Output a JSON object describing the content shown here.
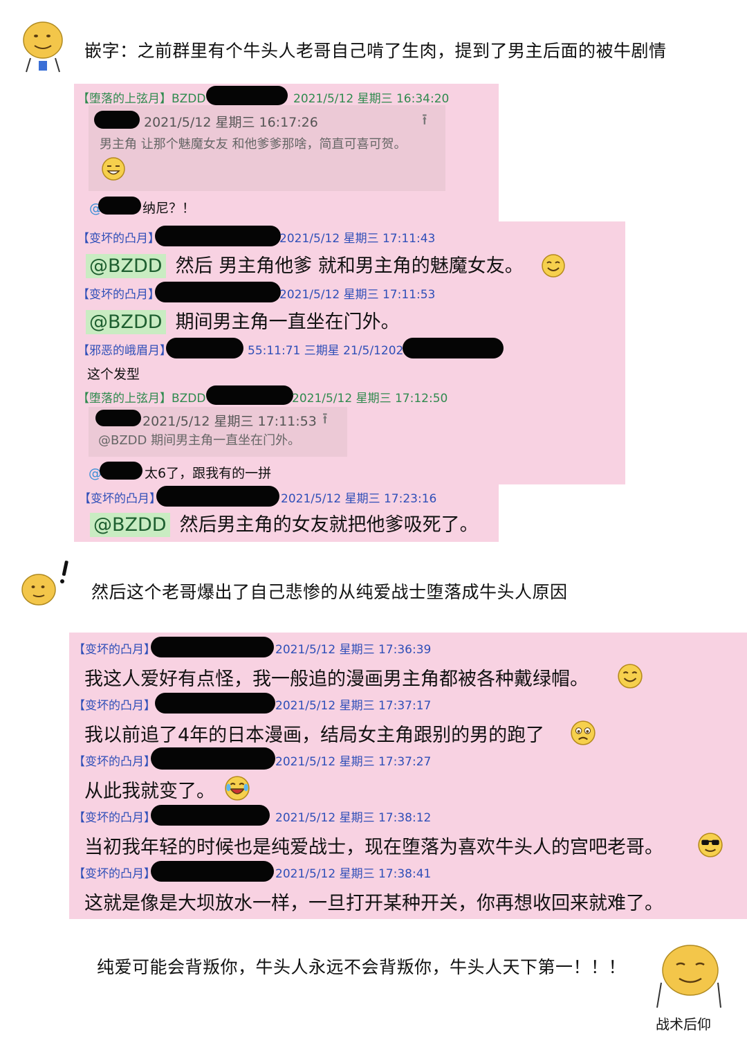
{
  "captions": {
    "intro": "嵌字：之前群里有个牛头人老哥自己啃了生肉，提到了男主后面的被牛剧情",
    "middle": "然后这个老哥爆出了自己悲惨的从纯爱战士堕落成牛头人原因",
    "closing": "纯爱可能会背叛你，牛头人永远不会背叛你，牛头人天下第一！！！",
    "sticker_label": "战术后仰"
  },
  "chat1": [
    {
      "tag": "【堕落的上弦月】",
      "name_prefix": "BZDD",
      "time": "2021/5/12 星期三 16:34:20",
      "quote_time": "2021/5/12 星期三 16:17:26",
      "quote_text": "男主角 让那个魅魔女友  和他爹爹那啥，简直可喜可贺。",
      "at": "@",
      "text": "纳尼？！"
    },
    {
      "tag": "【变坏的凸月】",
      "time": "2021/5/12 星期三 17:11:43",
      "mention": "@BZDD",
      "text": "然后 男主角他爹 就和男主角的魅魔女友。"
    },
    {
      "tag": "【变坏的凸月】",
      "time": "2021/5/12 星期三 17:11:53",
      "mention": "@BZDD",
      "text": "期间男主角一直坐在门外。"
    },
    {
      "tag": "【邪恶的峨眉月】",
      "time": "55:11:71 三期星 21/5/1202",
      "text": "这个发型"
    },
    {
      "tag": "【堕落的上弦月】",
      "name_prefix": "BZDD",
      "time": "2021/5/12 星期三 17:12:50",
      "quote_time": "2021/5/12 星期三 17:11:53",
      "quote_text": "@BZDD  期间男主角一直坐在门外。",
      "at": "@",
      "text": "太6了，跟我有的一拼"
    },
    {
      "tag": "【变坏的凸月】",
      "time": "2021/5/12 星期三 17:23:16",
      "mention": "@BZDD",
      "text": "然后男主角的女友就把他爹吸死了。"
    }
  ],
  "chat2": [
    {
      "tag": "【变坏的凸月】",
      "time": "2021/5/12 星期三 17:36:39",
      "text": "我这人爱好有点怪，我一般追的漫画男主角都被各种戴绿帽。"
    },
    {
      "tag": "【变坏的凸月】",
      "time": "2021/5/12 星期三 17:37:17",
      "text": "我以前追了4年的日本漫画，结局女主角跟别的男的跑了"
    },
    {
      "tag": "【变坏的凸月】",
      "time": "2021/5/12 星期三 17:37:27",
      "text": "从此我就变了。"
    },
    {
      "tag": "【变坏的凸月】",
      "time": "2021/5/12 星期三 17:38:12",
      "text": "当初我年轻的时候也是纯爱战士，现在堕落为喜欢牛头人的宫吧老哥。"
    },
    {
      "tag": "【变坏的凸月】",
      "time": "2021/5/12 星期三 17:38:41",
      "text": "这就是像是大坝放水一样，一旦打开某种开关，你再想收回来就难了。"
    }
  ],
  "colors": {
    "panel": "#f8d2e2",
    "quote": "#ecc9d6",
    "mention_bg": "#c9ecc2",
    "tag_blue": "#2f4fb8",
    "tag_green": "#2f8a4e",
    "redaction": "#050505"
  },
  "icons": [
    "doge-face-icon",
    "grin-emoji-icon",
    "smile-emoji-icon",
    "laugh-cry-emoji-icon",
    "sad-emoji-icon",
    "sunglasses-emoji-icon"
  ]
}
